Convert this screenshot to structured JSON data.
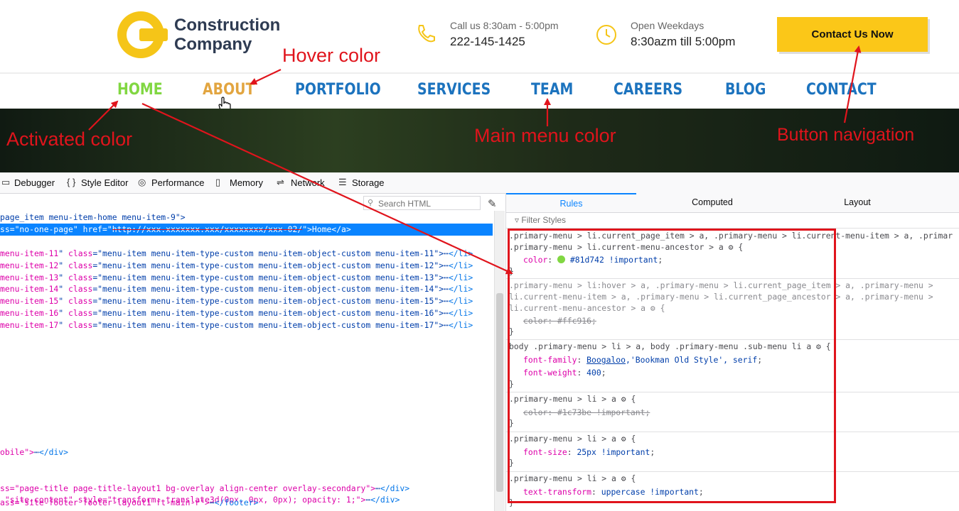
{
  "site": {
    "logo_line1": "Construction",
    "logo_line2": "Company",
    "call_label": "Call us 8:30am - 5:00pm",
    "call_value": "222-145-1425",
    "open_label": "Open Weekdays",
    "open_value": "8:30azm till 5:00pm",
    "contact_button": "Contact Us Now",
    "phone_icon": "phone-icon",
    "clock_icon": "clock-icon"
  },
  "menu": {
    "home": "HOME",
    "about": "ABOUT",
    "portfolio": "PORTFOLIO",
    "services": "SERVICES",
    "team": "TEAM",
    "careers": "CAREERS",
    "blog": "BLOG",
    "contact": "CONTACT",
    "colors": {
      "activated": "#81d742",
      "hover": "#ffc916",
      "main": "#1c73be"
    }
  },
  "annotations": {
    "hover_color": "Hover color",
    "activated_color": "Activated color",
    "main_menu_color": "Main menu color",
    "button_navigation": "Button navigation",
    "color": "#e0141c"
  },
  "devtools": {
    "tabs": {
      "debugger": "Debugger",
      "style_editor": "Style Editor",
      "performance": "Performance",
      "memory": "Memory",
      "network": "Network",
      "storage": "Storage"
    },
    "search_placeholder": "Search HTML",
    "html_lines": {
      "l0": "page_item menu-item-home menu-item-9\">",
      "l1": "ss=\"no-one-page\" href=\"",
      "l1_href": "http://xxx.xxxxxxx.xxx/xxxxxxxx/xxx-02/",
      "l1_end": "\">Home</a>",
      "items": [
        {
          "id": "menu-item-11",
          "cls": "menu-item menu-item-type-custom menu-item-object-custom menu-item-11"
        },
        {
          "id": "menu-item-12",
          "cls": "menu-item menu-item-type-custom menu-item-object-custom menu-item-12"
        },
        {
          "id": "menu-item-13",
          "cls": "menu-item menu-item-type-custom menu-item-object-custom menu-item-13"
        },
        {
          "id": "menu-item-14",
          "cls": "menu-item menu-item-type-custom menu-item-object-custom menu-item-14"
        },
        {
          "id": "menu-item-15",
          "cls": "menu-item menu-item-type-custom menu-item-object-custom menu-item-15"
        },
        {
          "id": "menu-item-16",
          "cls": "menu-item menu-item-type-custom menu-item-object-custom menu-item-16"
        },
        {
          "id": "menu-item-17",
          "cls": "menu-item menu-item-type-custom menu-item-object-custom menu-item-17"
        }
      ],
      "mobile": "obile\">",
      "page_title": "ss=\"page-title page-title-layout1 bg-overlay align-center overlay-secondary\">",
      "site_content": " \"site-content\" style=\"transform: translate3d(0px, 0px, 0px); opacity: 1;\">",
      "footer": "ass=\"site-footer footer-layout1 ft-main-r\">"
    },
    "side_tabs": {
      "rules": "Rules",
      "computed": "Computed",
      "layout": "Layout"
    },
    "filter_placeholder": "Filter Styles",
    "rules": {
      "r1_sel1": ".primary-menu > li.current_page_item > a, .primary-menu > li.current-menu-item > a, .primar",
      "r1_sel2": ".primary-menu > li.current-menu-ancestor > a",
      "r1_prop": "color",
      "r1_val": "#81d742 !important",
      "r2_sel1": ".primary-menu > li:hover > a, .primary-menu > li.current_page_item > a, .primary-menu >",
      "r2_sel2": "li.current-menu-item > a, .primary-menu > li.current_page_ancestor > a, .primary-menu >",
      "r2_sel3": "li.current-menu-ancestor > a",
      "r2_prop": "color",
      "r2_val": "#ffc916",
      "r3_sel": "body .primary-menu > li > a, body .primary-menu .sub-menu li a",
      "r3_prop1": "font-family",
      "r3_val1a": "Boogaloo",
      "r3_val1b": ",'Bookman Old Style', serif",
      "r3_prop2": "font-weight",
      "r3_val2": "400",
      "r4_sel": ".primary-menu > li > a",
      "r4_prop": "color",
      "r4_val": "#1c73be !important",
      "r5_sel": ".primary-menu > li > a",
      "r5_prop": "font-size",
      "r5_val": "25px !important",
      "r6_sel": ".primary-menu > li > a",
      "r6_prop": "text-transform",
      "r6_val": "uppercase !important"
    }
  }
}
